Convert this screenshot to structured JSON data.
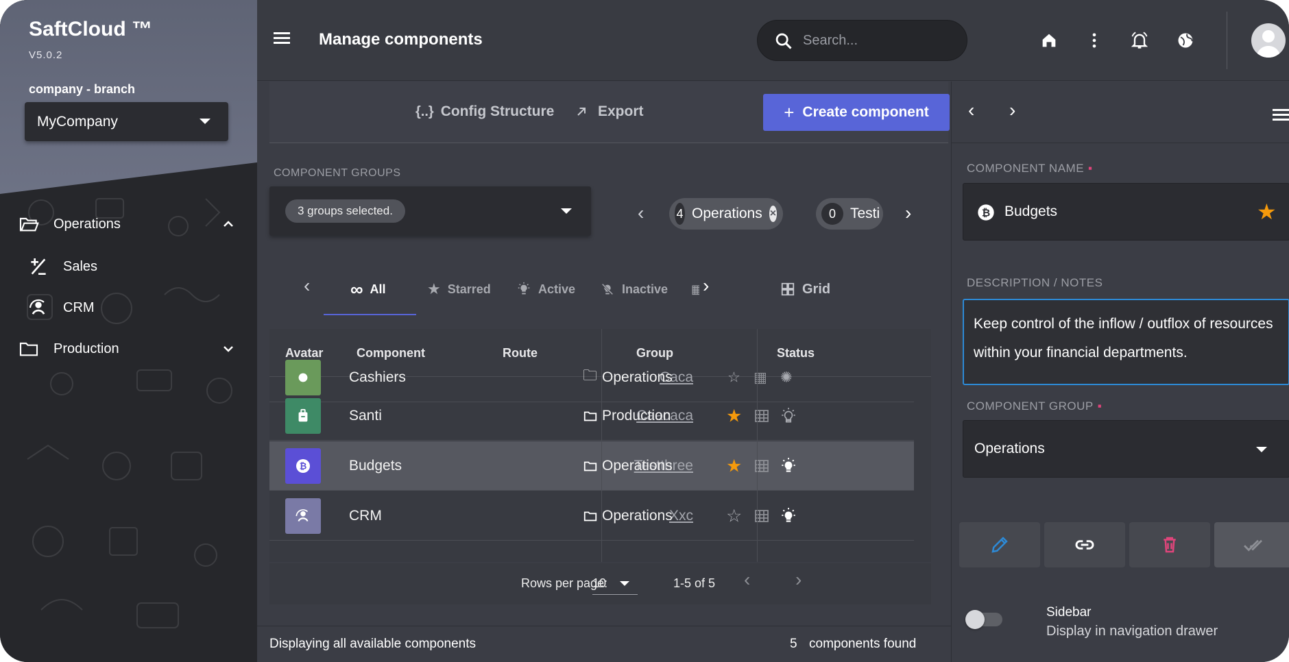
{
  "sidebar": {
    "brand": "SaftCloud ™",
    "version": "V5.0.2",
    "branch_label": "company - branch",
    "company": "MyCompany",
    "items": [
      {
        "label": "Operations",
        "icon": "folder-open-icon",
        "expanded": true
      },
      {
        "label": "Sales",
        "icon": "plus-minus-icon"
      },
      {
        "label": "CRM",
        "icon": "account-sync-icon"
      },
      {
        "label": "Production",
        "icon": "folder-icon",
        "expanded": false
      }
    ]
  },
  "header": {
    "title": "Manage components",
    "search_placeholder": "Search...",
    "icons": [
      "home-icon",
      "more-vertical-icon",
      "bell-icon",
      "globe-icon"
    ]
  },
  "toolbar": {
    "config": "Config Structure",
    "export": "Export",
    "create": "Create component"
  },
  "groups": {
    "label": "COMPONENT GROUPS",
    "selected": "3 groups selected.",
    "chips": [
      {
        "count": "4",
        "label": "Operations"
      },
      {
        "count": "0",
        "label": "Testi"
      }
    ]
  },
  "tabs": [
    {
      "label": "All",
      "icon": "infinity-icon",
      "active": true
    },
    {
      "label": "Starred",
      "icon": "star-icon"
    },
    {
      "label": "Active",
      "icon": "lightbulb-on-icon"
    },
    {
      "label": "Inactive",
      "icon": "lightbulb-off-icon"
    }
  ],
  "view_toggle": "Grid",
  "table": {
    "headers": {
      "avatar": "Avatar",
      "component": "Component",
      "route": "Route",
      "group": "Group",
      "status": "Status"
    },
    "rows": [
      {
        "name": "Cashiers",
        "route": "Caca",
        "group": "Operations",
        "starred": false,
        "active": false,
        "color": "#6a9a5b"
      },
      {
        "name": "Santi",
        "route": "Caacaca",
        "group": "Production",
        "starred": true,
        "active": false,
        "color": "#3e8a66"
      },
      {
        "name": "Budgets",
        "route": "Testthree",
        "group": "Operations",
        "starred": true,
        "active": true,
        "color": "#5b4fd6",
        "selected": true
      },
      {
        "name": "CRM",
        "route": "Xxc",
        "group": "Operations",
        "starred": false,
        "active": true,
        "color": "#7a7aa6"
      }
    ]
  },
  "pager": {
    "rows_label": "Rows per page:",
    "rows_value": "10",
    "range": "1-5 of 5"
  },
  "footer": {
    "left": "Displaying all available components",
    "count": "5",
    "right": "components found"
  },
  "panel": {
    "name_label": "COMPONENT NAME",
    "name_value": "Budgets",
    "desc_label": "DESCRIPTION / NOTES",
    "desc_value": "Keep control of the inflow / outflox of resources within your financial departments.",
    "group_label": "COMPONENT GROUP",
    "group_value": "Operations",
    "sidebar_title": "Sidebar",
    "sidebar_sub": "Display in navigation drawer"
  },
  "colors": {
    "accent": "#5865d8",
    "star": "#f59a0c",
    "delete": "#e0457b",
    "edit": "#2d8ad6"
  }
}
